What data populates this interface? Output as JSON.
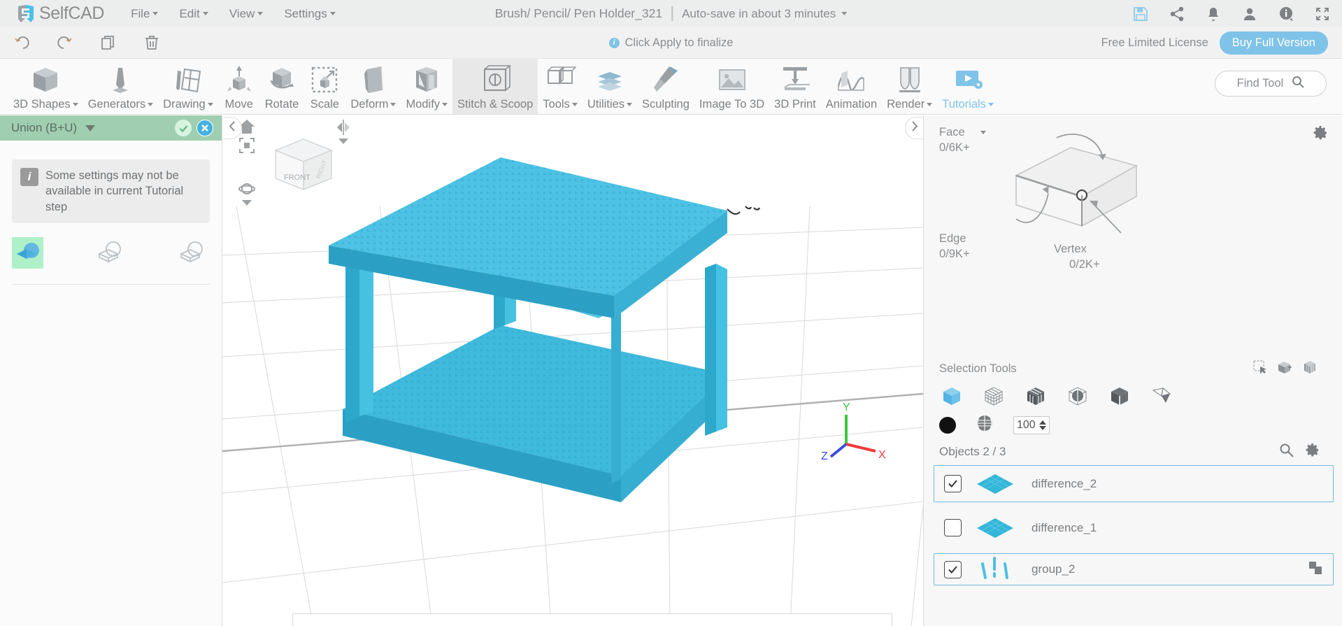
{
  "menubar": {
    "brand": "SelfCAD",
    "brand_icon": "selfcad-logo-icon",
    "items": [
      {
        "label": "File",
        "icon": "chevron-down-icon"
      },
      {
        "label": "Edit",
        "icon": "chevron-down-icon"
      },
      {
        "label": "View",
        "icon": "chevron-down-icon"
      },
      {
        "label": "Settings",
        "icon": "chevron-down-icon"
      }
    ],
    "document_title": "Brush/ Pencil/ Pen Holder_321",
    "autosave_label": "Auto-save in about 3 minutes",
    "icons": [
      {
        "name": "save-icon"
      },
      {
        "name": "share-icon"
      },
      {
        "name": "notifications-bell-icon"
      },
      {
        "name": "user-account-icon"
      },
      {
        "name": "info-icon"
      },
      {
        "name": "fullscreen-icon"
      }
    ]
  },
  "actionbar": {
    "undo_icon": "undo-icon",
    "redo_icon": "redo-icon",
    "copy_icon": "copy-icon",
    "delete_icon": "trash-icon",
    "apply_hint": "Click Apply to finalize",
    "license_text": "Free Limited License",
    "buy_label": "Buy Full Version"
  },
  "ribbon": {
    "tools": [
      {
        "label": "3D Shapes",
        "icon": "cube-icon",
        "dropdown": true
      },
      {
        "label": "Generators",
        "icon": "generator-icon",
        "dropdown": true
      },
      {
        "label": "Drawing",
        "icon": "pencil-sketch-icon",
        "dropdown": true
      },
      {
        "label": "Move",
        "icon": "move-arrows-icon",
        "dropdown": false
      },
      {
        "label": "Rotate",
        "icon": "rotate-icon",
        "dropdown": false
      },
      {
        "label": "Scale",
        "icon": "scale-icon",
        "dropdown": false
      },
      {
        "label": "Deform",
        "icon": "deform-icon",
        "dropdown": true
      },
      {
        "label": "Modify",
        "icon": "modify-icon",
        "dropdown": true
      },
      {
        "label": "Stitch & Scoop",
        "icon": "stitch-scoop-icon",
        "dropdown": false,
        "active": true
      },
      {
        "label": "Tools",
        "icon": "tools-icon",
        "dropdown": true
      },
      {
        "label": "Utilities",
        "icon": "utilities-icon",
        "dropdown": true
      },
      {
        "label": "Sculpting",
        "icon": "sculpting-icon",
        "dropdown": false
      },
      {
        "label": "Image To 3D",
        "icon": "image-to-3d-icon",
        "dropdown": false
      },
      {
        "label": "3D Print",
        "icon": "printer-icon",
        "dropdown": false
      },
      {
        "label": "Animation",
        "icon": "animation-icon",
        "dropdown": false
      },
      {
        "label": "Render",
        "icon": "render-icon",
        "dropdown": true
      },
      {
        "label": "Tutorials",
        "icon": "tutorials-play-icon",
        "dropdown": true,
        "highlight": true
      }
    ],
    "find_tool_label": "Find Tool",
    "find_tool_icon": "search-icon"
  },
  "left_panel": {
    "title": "Union (B+U)",
    "confirm_icon": "check-icon",
    "cancel_icon": "close-icon",
    "note": "Some settings may not be available in current Tutorial step",
    "note_icon": "info-square-icon",
    "operations": [
      {
        "name": "union-op",
        "selected": true
      },
      {
        "name": "subtract-op",
        "selected": false
      },
      {
        "name": "intersect-op",
        "selected": false
      }
    ]
  },
  "viewport": {
    "collapse_left_icon": "chevron-left-icon",
    "collapse_right_icon": "chevron-right-icon",
    "home_icon": "home-icon",
    "frame-selection_icon": "frame-selection-icon",
    "mirror_icon": "mirror-icon",
    "orbit_icon": "orbit-icon",
    "cube_front_label": "FRONT",
    "axis": {
      "x": "X",
      "y": "Y",
      "z": "Z"
    }
  },
  "right_panel": {
    "settings_icon": "gear-icon",
    "face": {
      "label": "Face",
      "value": "0/6K+",
      "dropdown_icon": "chevron-down-icon"
    },
    "edge": {
      "label": "Edge",
      "value": "0/9K+"
    },
    "vertex": {
      "label": "Vertex",
      "value": "0/2K+"
    },
    "selection_tools_label": "Selection Tools",
    "selection_mini_icons": [
      {
        "name": "rect-select-icon"
      },
      {
        "name": "box-select-icon"
      },
      {
        "name": "through-select-icon"
      }
    ],
    "selection_types": [
      {
        "name": "object-select-icon",
        "active": true
      },
      {
        "name": "mesh-grid-select-icon",
        "active": false
      },
      {
        "name": "voxel-select-icon",
        "active": false
      },
      {
        "name": "sphere-select-icon",
        "active": false
      },
      {
        "name": "face-select-icon",
        "active": false
      },
      {
        "name": "polygon-select-icon",
        "active": false
      }
    ],
    "material": {
      "color_swatch": "#111111",
      "texture_icon": "texture-sphere-icon",
      "opacity_value": "100"
    },
    "objects_label": "Objects 2 / 3",
    "objects_search_icon": "search-icon",
    "objects_settings_icon": "gear-icon",
    "objects": [
      {
        "name": "difference_2",
        "checked": true,
        "selected": true,
        "thumb": "diamond-mesh-thumb"
      },
      {
        "name": "difference_1",
        "checked": false,
        "selected": false,
        "thumb": "diamond-mesh-thumb"
      },
      {
        "name": "group_2",
        "checked": true,
        "selected": true,
        "thumb": "group-strokes-thumb",
        "trailing_icon": "group-icon"
      }
    ]
  },
  "colors": {
    "accent": "#7fc3e8",
    "model": "#35b6d8",
    "panel_header": "#9fcfb0",
    "selected_border": "#72b9e0"
  }
}
